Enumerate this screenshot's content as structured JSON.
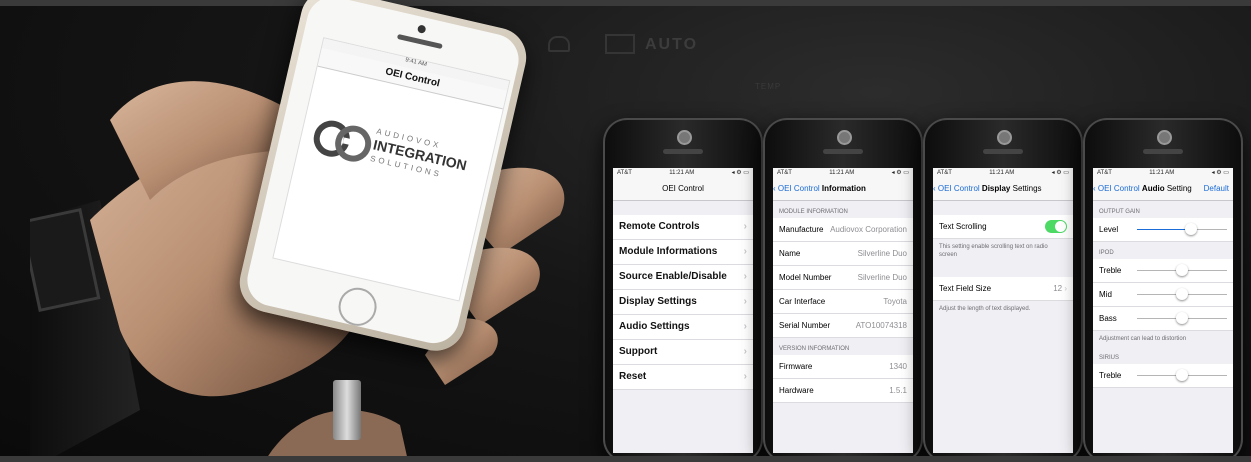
{
  "hero_phone": {
    "status_left": "●●●●○ ",
    "status_time": "9:41 AM",
    "title": "OEI Control",
    "logo": {
      "line1": "AUDIOVOX",
      "line2": "INTEGRATION",
      "line3": "SOLUTIONS"
    }
  },
  "dashboard": {
    "auto": "AUTO",
    "temp": "TEMP"
  },
  "status": {
    "carrier": "AT&T",
    "time": "11:21 AM",
    "icons": "◂ ⚙ ▭"
  },
  "screen1": {
    "title": "OEI Control",
    "items": [
      {
        "label": "Remote Controls"
      },
      {
        "label": "Module Informations"
      },
      {
        "label": "Source Enable/Disable"
      },
      {
        "label": "Display Settings"
      },
      {
        "label": "Audio Settings"
      },
      {
        "label": "Support"
      },
      {
        "label": "Reset"
      }
    ]
  },
  "screen2": {
    "back": "OEI Control",
    "title": "Information",
    "section1": "MODULE INFORMATION",
    "rows1": [
      {
        "label": "Manufacture",
        "value": "Audiovox Corporation"
      },
      {
        "label": "Name",
        "value": "Silverline Duo"
      },
      {
        "label": "Model Number",
        "value": "Silverline Duo"
      },
      {
        "label": "Car Interface",
        "value": "Toyota"
      },
      {
        "label": "Serial Number",
        "value": "ATO10074318"
      }
    ],
    "section2": "VERSION INFORMATION",
    "rows2": [
      {
        "label": "Firmware",
        "value": "1340"
      },
      {
        "label": "Hardware",
        "value": "1.5.1"
      }
    ]
  },
  "screen3": {
    "back": "OEI Control",
    "title_bold": "Display",
    "title_rest": "Settings",
    "text_scrolling": "Text Scrolling",
    "text_scrolling_on": true,
    "text_scrolling_note": "This setting enable scrolling text on radio screen",
    "field_size_label": "Text Field Size",
    "field_size_value": "12",
    "field_size_note": "Adjust the length of text displayed."
  },
  "screen4": {
    "back": "OEI Control",
    "title_bold": "Audio",
    "title_rest": "Setting",
    "right": "Default",
    "section_gain": "OUTPUT GAIN",
    "level_label": "Level",
    "level": 0.62,
    "section_ipod": "IPOD",
    "ipod": [
      {
        "label": "Treble",
        "level": 0.5
      },
      {
        "label": "Mid",
        "level": 0.5
      },
      {
        "label": "Bass",
        "level": 0.5
      }
    ],
    "ipod_note": "Adjustment can lead to distortion",
    "section_sirius": "SIRIUS",
    "sirius": [
      {
        "label": "Treble",
        "level": 0.5
      }
    ]
  }
}
